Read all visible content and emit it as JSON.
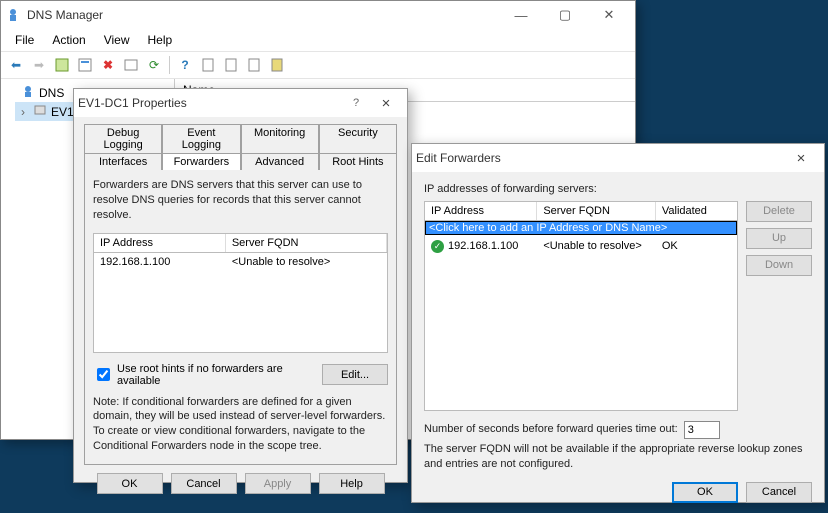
{
  "main": {
    "title": "DNS Manager",
    "menus": [
      "File",
      "Action",
      "View",
      "Help"
    ],
    "tree": {
      "root": "DNS",
      "node": "EV1-DC1"
    },
    "list_header": "Name"
  },
  "props": {
    "title": "EV1-DC1 Properties",
    "help_glyph": "?",
    "close_glyph": "×",
    "tabs_row1": [
      "Debug Logging",
      "Event Logging",
      "Monitoring",
      "Security"
    ],
    "tabs_row2": [
      "Interfaces",
      "Forwarders",
      "Advanced",
      "Root Hints"
    ],
    "active_tab": "Forwarders",
    "desc": "Forwarders are DNS servers that this server can use to resolve DNS queries for records that this server cannot resolve.",
    "col_ip": "IP Address",
    "col_fqdn": "Server FQDN",
    "row_ip": "192.168.1.100",
    "row_fqdn": "<Unable to resolve>",
    "cb_label": "Use root hints if no forwarders are available",
    "edit_btn": "Edit...",
    "note": "Note: If conditional forwarders are defined for a given domain, they will be used instead of server-level forwarders.  To create or view conditional forwarders, navigate to the Conditional Forwarders node in the scope tree.",
    "btn_ok": "OK",
    "btn_cancel": "Cancel",
    "btn_apply": "Apply",
    "btn_help": "Help"
  },
  "edit": {
    "title": "Edit Forwarders",
    "close_glyph": "×",
    "label_top": "IP addresses of forwarding servers:",
    "col_ip": "IP Address",
    "col_fqdn": "Server FQDN",
    "col_val": "Validated",
    "placeholder": "<Click here to add an IP Address or DNS Name>",
    "row_ip": "192.168.1.100",
    "row_fqdn": "<Unable to resolve>",
    "row_val": "OK",
    "btn_delete": "Delete",
    "btn_up": "Up",
    "btn_down": "Down",
    "timeout_label": "Number of seconds before forward queries time out:",
    "timeout_value": "3",
    "note": "The server FQDN will not be available if the appropriate reverse lookup zones and entries are not configured.",
    "btn_ok": "OK",
    "btn_cancel": "Cancel"
  }
}
